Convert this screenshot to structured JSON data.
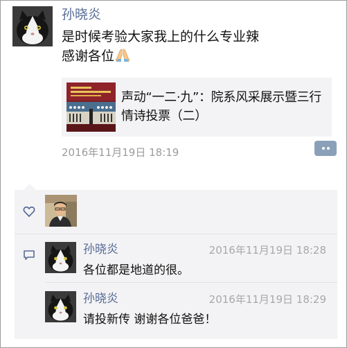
{
  "post": {
    "author": "孙晓炎",
    "line1": "是时候考验大家我上的什么专业辣",
    "line2": "感谢各位",
    "emoji_name": "praying-hands-emoji",
    "time": "2016年11月19日 18:19"
  },
  "link_card": {
    "title": "声动“一二·九”：院系风采展示暨三行情诗投票（二）",
    "thumbnail_name": "stage-performance-thumbnail"
  },
  "social": {
    "like_icon": "heart-icon",
    "comment_icon": "comment-icon",
    "comments": [
      {
        "author": "孙晓炎",
        "time": "2016年11月19日 18:28",
        "text": "各位都是地道的很。"
      },
      {
        "author": "孙晓炎",
        "time": "2016年11月19日 18:29",
        "text": "请投新传 谢谢各位爸爸！"
      }
    ]
  },
  "colors": {
    "name_blue": "#576b95",
    "meta_gray": "#9b9b9b",
    "panel_bg": "#f3f3f5"
  }
}
